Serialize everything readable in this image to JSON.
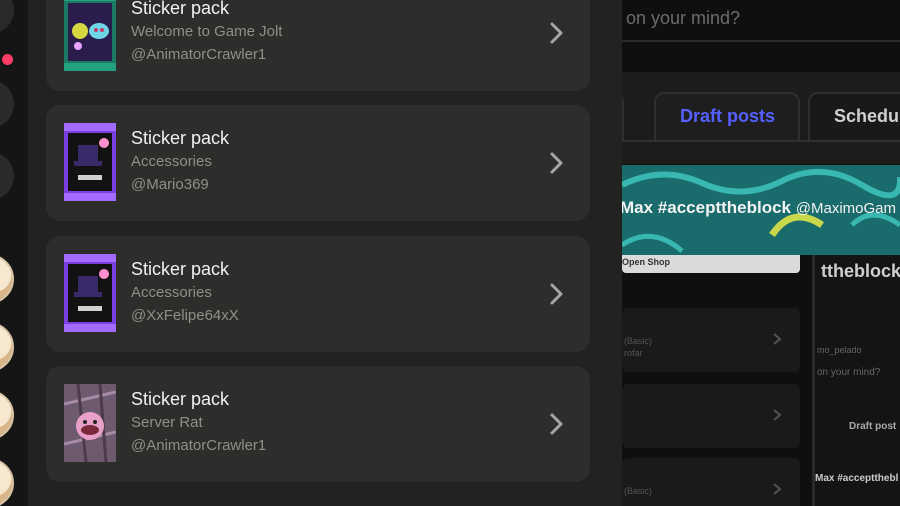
{
  "sticker_packs": [
    {
      "title": "Sticker pack",
      "subtitle": "Welcome to Game Jolt",
      "author": "@AnimatorCrawler1",
      "theme": "green"
    },
    {
      "title": "Sticker pack",
      "subtitle": "Accessories",
      "author": "@Mario369",
      "theme": "purple"
    },
    {
      "title": "Sticker pack",
      "subtitle": "Accessories",
      "author": "@XxFelipe64xX",
      "theme": "purple"
    },
    {
      "title": "Sticker pack",
      "subtitle": "Server Rat",
      "author": "@AnimatorCrawler1",
      "theme": "plaid"
    }
  ],
  "background": {
    "composer_placeholder": "on your mind?",
    "tabs": [
      {
        "label": "Draft posts",
        "active": true
      },
      {
        "label": "Schedul"
      }
    ],
    "banner_title": "Max #accepttheblock",
    "banner_user": "@MaximoGam",
    "shop_button": "Open Shop",
    "inner": {
      "title": "ttheblock",
      "user": "mo_pelado",
      "composer": "on your mind?",
      "tab": "Draft post",
      "banner": "Max #acceptthebl",
      "basic_1": "(Basic)",
      "basic_2": "(Basic)",
      "sub": "rofar"
    }
  },
  "colors": {
    "panel": "#222220",
    "card": "#2d2d2b",
    "active_tab": "#5560ff",
    "notification_dot": "#ff3d67"
  }
}
